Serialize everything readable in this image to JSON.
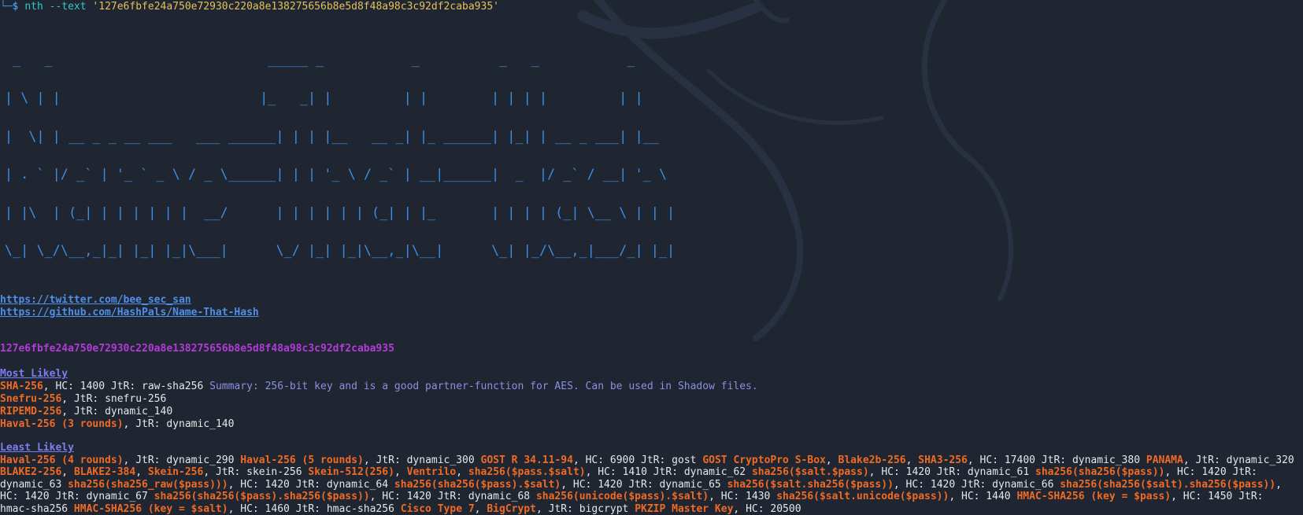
{
  "terminal": {
    "prompt_corner": "└─",
    "prompt_dollar": "$",
    "command": "nth",
    "flag": "--text",
    "argument": "'127e6fbfe24a750e72930c220a8e138275656b8e5d8f48a98c3c92df2caba935'"
  },
  "banner": {
    "lines": [
      " _   _                           _____ _           _          _   _           _     ",
      "| \\ | |                         |_   _| |         | |        | | | |         | |    ",
      "|  \\| | __ _ _ __ ___   ___ ______| | | |__   __ _| |_ ______| |_| | __ _ ___| |__  ",
      "| . ` |/ _` | '_ ` _ \\ / _ \\______| | | '_ \\ / _` | __|______|  _  |/ _` / __| '_ \\ ",
      "| |\\  | (_| | | | | | |  __/      | | | | | | (_| | |_       | | | | (_| \\__ \\ | | |",
      "\\_| \\_/\\__,_|_| |_| |_|\\___|      \\_/ |_| |_|\\__,_|\\__|      \\_| |_/\\__,_|___/_| |_|"
    ]
  },
  "links": {
    "twitter": "https://twitter.com/bee_sec_san",
    "github": "https://github.com/HashPals/Name-That-Hash"
  },
  "hash": "127e6fbfe24a750e72930c220a8e138275656b8e5d8f48a98c3c92df2caba935",
  "most_likely": {
    "heading": "Most Likely",
    "rows": [
      {
        "name": "SHA-256",
        "rest": ", HC: 1400 JtR: raw-sha256 ",
        "summary": "Summary: 256-bit key and is a good partner-function for AES. Can be used in Shadow files."
      },
      {
        "name": "Snefru-256",
        "rest": ", JtR: snefru-256",
        "summary": ""
      },
      {
        "name": "RIPEMD-256",
        "rest": ", JtR: dynamic_140",
        "summary": ""
      },
      {
        "name": "Haval-256 (3 rounds)",
        "rest": ", JtR: dynamic_140",
        "summary": ""
      }
    ]
  },
  "least_likely": {
    "heading": "Least Likely",
    "items": [
      {
        "name": "Haval-256 (4 rounds)",
        "rest": ", JtR: dynamic_290 "
      },
      {
        "name": "Haval-256 (5 rounds)",
        "rest": ", JtR: dynamic_300 "
      },
      {
        "name": "GOST R 34.11-94",
        "rest": ", HC: 6900 JtR: gost "
      },
      {
        "name": "GOST CryptoPro S-Box",
        "rest": ",  "
      },
      {
        "name": "Blake2b-256",
        "rest": ",  "
      },
      {
        "name": "SHA3-256",
        "rest": ", HC: 17400 JtR: dynamic_380 "
      },
      {
        "name": "PANAMA",
        "rest": ", JtR: dynamic_320 "
      },
      {
        "name": "BLAKE2-256",
        "rest": ",  "
      },
      {
        "name": "BLAKE2-384",
        "rest": ",  "
      },
      {
        "name": "Skein-256",
        "rest": ", JtR: skein-256 "
      },
      {
        "name": "Skein-512(256)",
        "rest": ",  "
      },
      {
        "name": "Ventrilo",
        "rest": ",  "
      },
      {
        "name": "sha256($pass.$salt)",
        "rest": ", HC: 1410 JtR: dynamic_62 "
      },
      {
        "name": "sha256($salt.$pass)",
        "rest": ", HC: 1420 JtR: dynamic_61 "
      },
      {
        "name": "sha256(sha256($pass))",
        "rest": ", HC: 1420 JtR: dynamic_63 "
      },
      {
        "name": "sha256(sha256_raw($pass)))",
        "rest": ", HC: 1420 JtR: dynamic_64 "
      },
      {
        "name": "sha256(sha256($pass).$salt)",
        "rest": ", HC: 1420 JtR: dynamic_65 "
      },
      {
        "name": "sha256($salt.sha256($pass))",
        "rest": ", HC: 1420 JtR: dynamic_66 "
      },
      {
        "name": "sha256(sha256($salt).sha256($pass))",
        "rest": ", HC: 1420 JtR: dynamic_67 "
      },
      {
        "name": "sha256(sha256($pass).sha256($pass))",
        "rest": ", HC: 1420 JtR: dynamic_68 "
      },
      {
        "name": "sha256(unicode($pass).$salt)",
        "rest": ", HC: 1430  "
      },
      {
        "name": "sha256($salt.unicode($pass))",
        "rest": ", HC: 1440 "
      },
      {
        "name": "HMAC-SHA256 (key = $pass)",
        "rest": ", HC: 1450 JtR: hmac-sha256 "
      },
      {
        "name": "HMAC-SHA256 (key = $salt)",
        "rest": ", HC: 1460 JtR: hmac-sha256 "
      },
      {
        "name": "Cisco Type 7",
        "rest": ",  "
      },
      {
        "name": "BigCrypt",
        "rest": ", JtR: bigcrypt "
      },
      {
        "name": "PKZIP Master Key",
        "rest": ", HC: 20500"
      }
    ]
  },
  "colors": {
    "background": "#1f2632",
    "hash_name": "#f06a23",
    "link": "#4f8fe8",
    "banner": "#3d8fe6",
    "hash": "#b23bd9",
    "summary": "#8d8ee0"
  }
}
